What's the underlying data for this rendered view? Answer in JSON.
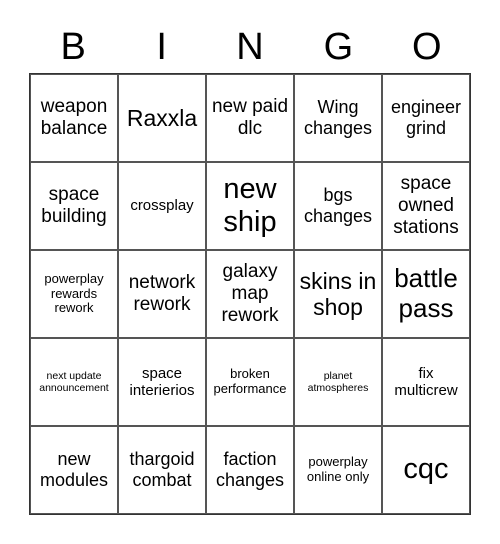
{
  "header": [
    "B",
    "I",
    "N",
    "G",
    "O"
  ],
  "cells": [
    [
      "weapon balance",
      "Raxxla",
      "new paid dlc",
      "Wing changes",
      "engineer grind"
    ],
    [
      "space building",
      "crossplay",
      "new ship",
      "bgs changes",
      "space owned stations"
    ],
    [
      "powerplay rewards rework",
      "network rework",
      "galaxy map rework",
      "skins in shop",
      "battle pass"
    ],
    [
      "next update announcement",
      "space interierios",
      "broken performance",
      "planet atmospheres",
      "fix multicrew"
    ],
    [
      "new modules",
      "thargoid combat",
      "faction changes",
      "powerplay online only",
      "cqc"
    ]
  ]
}
